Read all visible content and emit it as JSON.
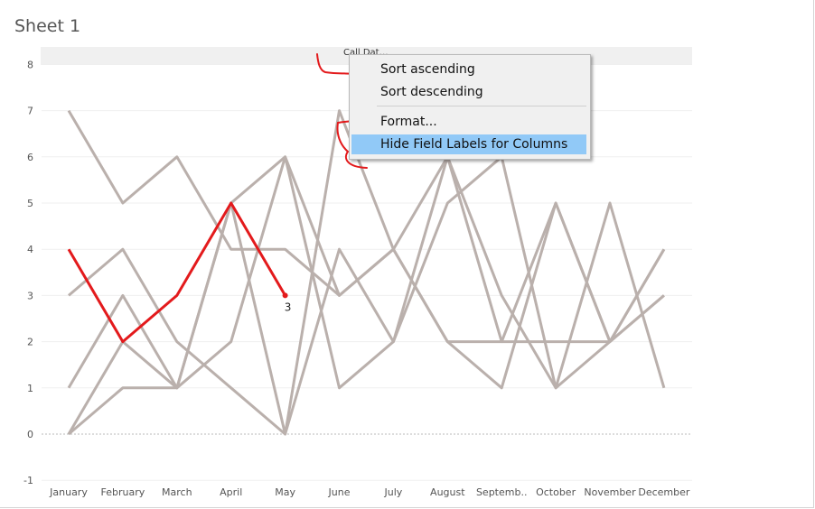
{
  "sheet": {
    "title": "Sheet 1",
    "column_header_text": "Call Dat…"
  },
  "context_menu": {
    "items": [
      {
        "label": "Sort ascending"
      },
      {
        "label": "Sort descending"
      },
      {
        "label": "Format..."
      },
      {
        "label": "Hide Field Labels for Columns",
        "highlighted": true
      }
    ]
  },
  "colors": {
    "highlight_series": "#e31a1c",
    "other_series": "#bab0ac",
    "annotation_ink": "#e31a1c",
    "menu_highlight": "#91c9f7"
  },
  "chart_data": {
    "type": "line",
    "categories": [
      "January",
      "February",
      "March",
      "April",
      "May",
      "June",
      "July",
      "August",
      "Septemb..",
      "October",
      "November",
      "December"
    ],
    "ylim": [
      -1,
      8
    ],
    "yticks": [
      "8",
      "7",
      "6",
      "5",
      "4",
      "3",
      "2",
      "1",
      "0",
      "-1"
    ],
    "grid": true,
    "series": [
      {
        "values": [
          7,
          5,
          6,
          4,
          4,
          3,
          4,
          2,
          2,
          5,
          2,
          3
        ]
      },
      {
        "values": [
          3,
          4,
          2,
          1,
          0,
          4,
          2,
          6,
          3,
          1,
          2,
          4
        ]
      },
      {
        "values": [
          1,
          3,
          1,
          5,
          0,
          7,
          4,
          2,
          1,
          5,
          2,
          3
        ]
      },
      {
        "values": [
          0,
          2,
          1,
          5,
          6,
          1,
          2,
          5,
          6,
          1,
          5,
          1
        ]
      },
      {
        "values": [
          0,
          1,
          1,
          2,
          6,
          3,
          4,
          6,
          2,
          2,
          2,
          4
        ]
      },
      {
        "values": [
          4,
          2,
          3,
          5,
          3
        ],
        "highlight": true,
        "end_label": "3"
      }
    ]
  }
}
